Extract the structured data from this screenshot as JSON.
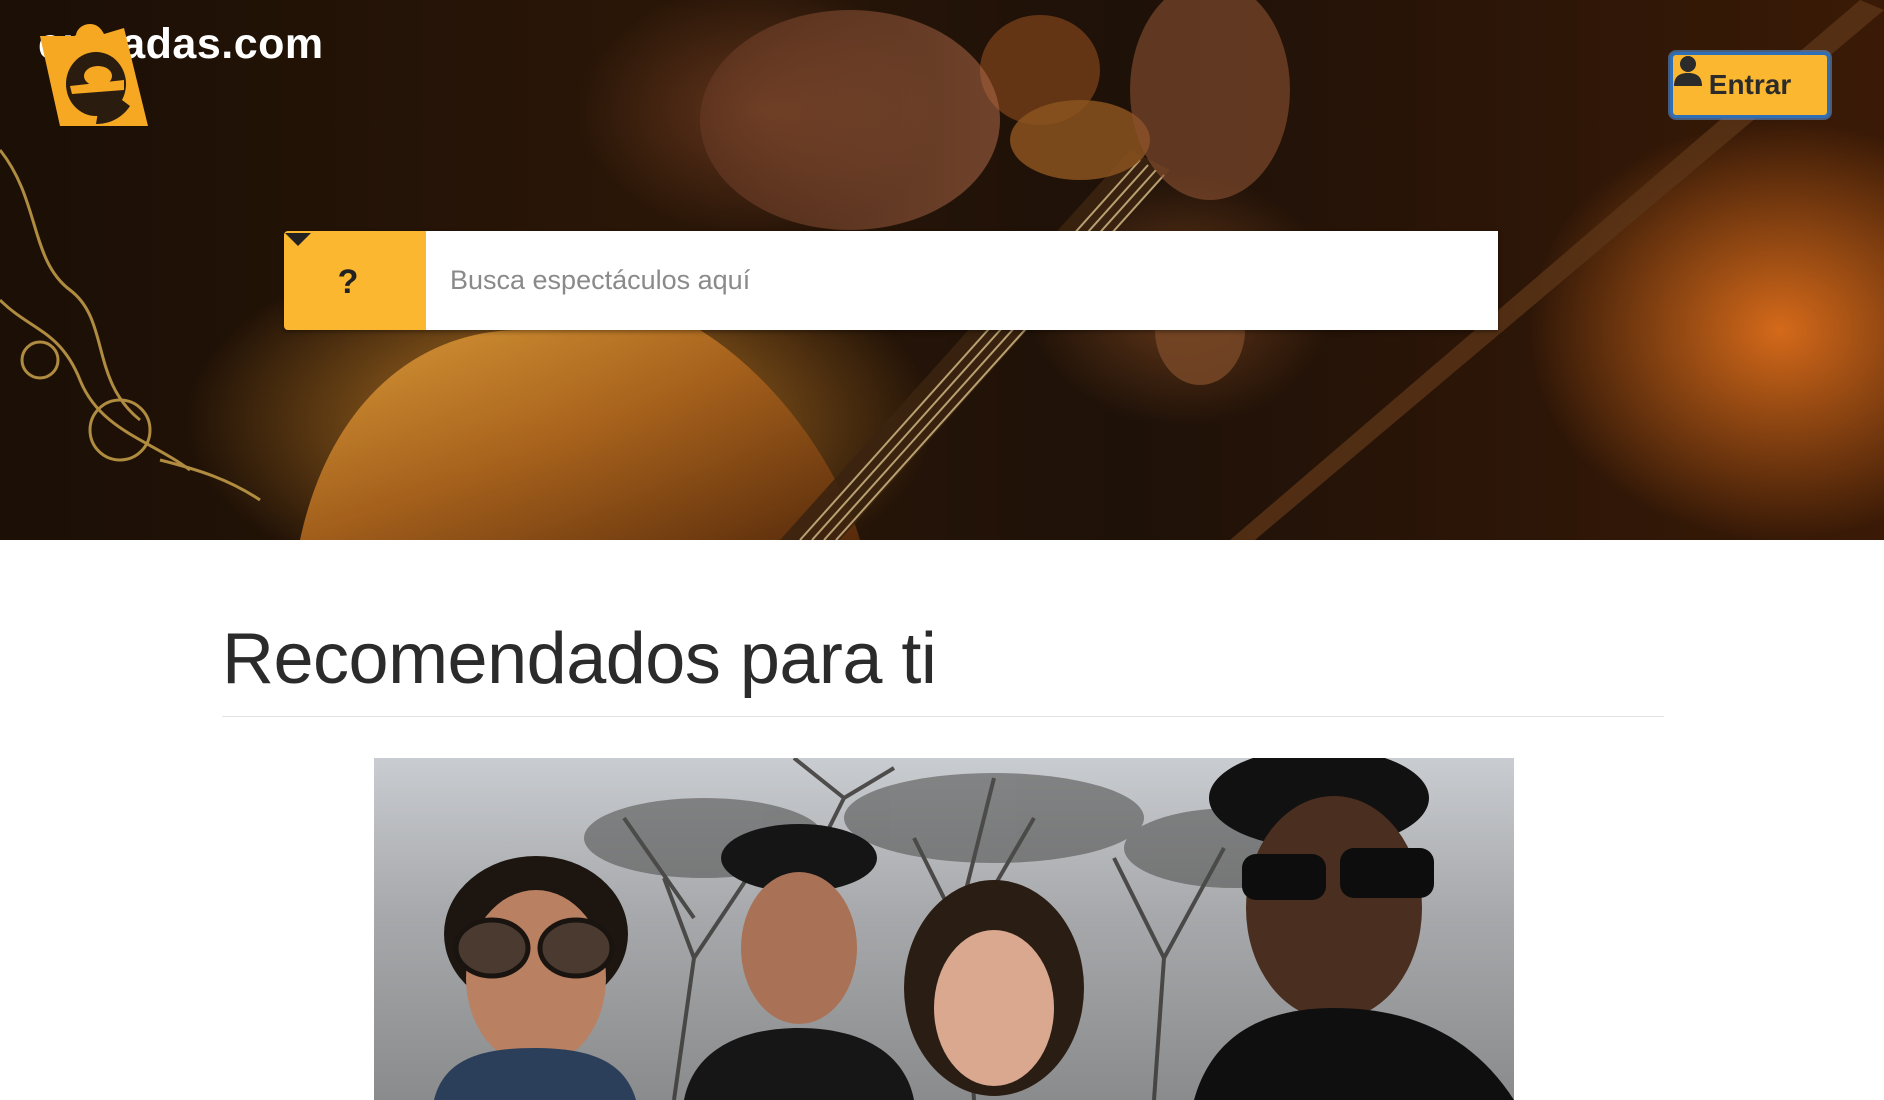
{
  "header": {
    "brand": "entradas.com",
    "logo_icon": "ticket-e-logo",
    "login_label": "Entrar",
    "login_icon": "user-icon"
  },
  "search": {
    "type_label": "?",
    "type_icon": "caret-down-icon",
    "placeholder": "Busca espectáculos aquí",
    "value": ""
  },
  "main": {
    "section_title": "Recomendados para ti"
  },
  "colors": {
    "accent": "#fbb72f",
    "text_dark": "#2b2b2b",
    "focus_border": "#2f6fb8"
  }
}
